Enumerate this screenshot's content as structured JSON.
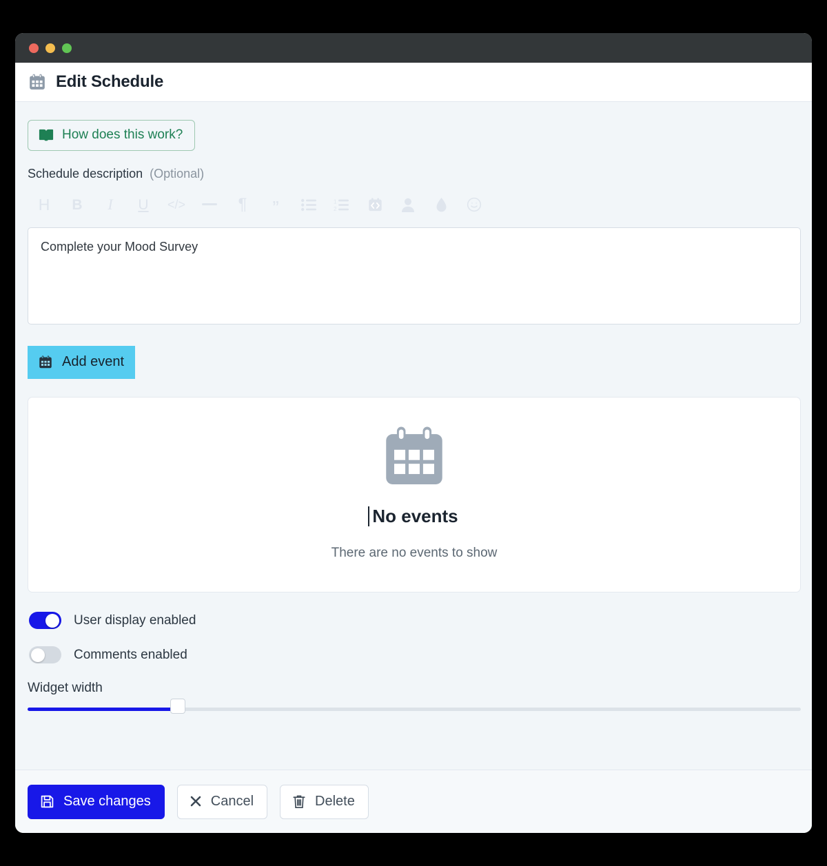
{
  "window": {
    "traffic_lights": [
      "close",
      "minimize",
      "maximize"
    ]
  },
  "header": {
    "icon": "calendar-icon",
    "title": "Edit Schedule"
  },
  "help": {
    "icon": "book-icon",
    "label": "How does this work?"
  },
  "description_field": {
    "label": "Schedule description",
    "optional_tag": "(Optional)",
    "value": "Complete your Mood Survey",
    "placeholder": ""
  },
  "rich_text_toolbar": {
    "buttons": [
      {
        "name": "heading-icon",
        "glyph": "H",
        "title": "Heading"
      },
      {
        "name": "bold-icon",
        "glyph": "B",
        "title": "Bold"
      },
      {
        "name": "italic-icon",
        "glyph": "I",
        "title": "Italic"
      },
      {
        "name": "underline-icon",
        "glyph": "U",
        "title": "Underline"
      },
      {
        "name": "code-icon",
        "glyph": "</>",
        "title": "Code"
      },
      {
        "name": "horizontal-rule-icon",
        "glyph": "—",
        "title": "Horizontal rule"
      },
      {
        "name": "paragraph-icon",
        "glyph": "¶",
        "title": "Paragraph"
      },
      {
        "name": "quote-icon",
        "glyph": "”",
        "title": "Quote"
      },
      {
        "name": "bullet-list-icon",
        "glyph": "",
        "title": "Bullet list"
      },
      {
        "name": "numbered-list-icon",
        "glyph": "",
        "title": "Numbered list"
      },
      {
        "name": "media-icon",
        "glyph": "",
        "title": "Insert media"
      },
      {
        "name": "person-icon",
        "glyph": "",
        "title": "Mention user"
      },
      {
        "name": "droplet-icon",
        "glyph": "",
        "title": "Color"
      },
      {
        "name": "emoji-icon",
        "glyph": "",
        "title": "Emoji"
      }
    ]
  },
  "add_event": {
    "icon": "calendar-plus-icon",
    "label": "Add event"
  },
  "events_panel": {
    "empty_icon": "calendar-icon",
    "empty_title": "No events",
    "empty_subtitle": "There are no events to show"
  },
  "settings": {
    "user_display": {
      "label": "User display enabled",
      "state": "on"
    },
    "comments": {
      "label": "Comments enabled",
      "state": "off"
    },
    "widget_width": {
      "label": "Widget width"
    }
  },
  "footer": {
    "save": {
      "icon": "save-icon",
      "label": "Save changes"
    },
    "cancel": {
      "icon": "close-icon",
      "label": "Cancel"
    },
    "delete": {
      "icon": "trash-icon",
      "label": "Delete"
    }
  },
  "colors": {
    "accent_blue": "#1818e8",
    "add_event_cyan": "#55ccf0",
    "help_green": "#1e8054",
    "page_bg": "#f2f6f9",
    "titlebar": "#333739"
  }
}
